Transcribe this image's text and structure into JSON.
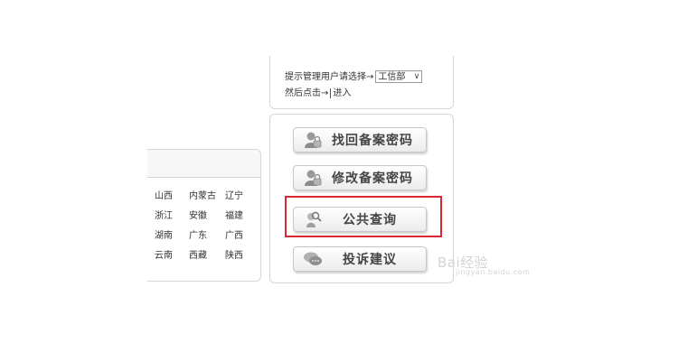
{
  "top_panel": {
    "hint_text": "提示管理用户请选择→",
    "selected_dept": "工信部",
    "then_text": "然后点击→",
    "enter_link": "进入"
  },
  "provinces": {
    "rows": [
      [
        "山西",
        "内蒙古",
        "辽宁"
      ],
      [
        "浙江",
        "安徽",
        "福建"
      ],
      [
        "湖南",
        "广东",
        "广西"
      ],
      [
        "云南",
        "西藏",
        "陕西"
      ]
    ]
  },
  "actions": {
    "recover_password": "找回备案密码",
    "change_password": "修改备案密码",
    "public_query": "公共查询",
    "complaint": "投诉建议"
  },
  "watermark": {
    "text": "Bai经验",
    "sub": "jingyan.baidu.com"
  },
  "colors": {
    "highlight": "#d9282f",
    "border": "#d6d6d6"
  }
}
